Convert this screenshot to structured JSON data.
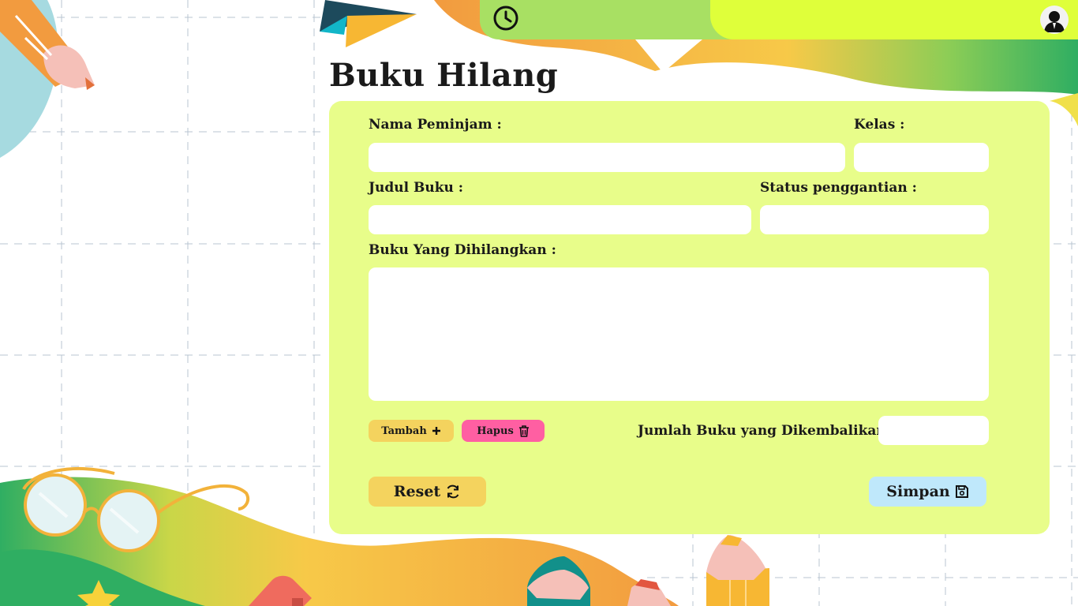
{
  "page": {
    "title": "Buku Hilang"
  },
  "header": {
    "clock_icon": "clock-icon",
    "avatar_icon": "user-avatar-icon"
  },
  "form": {
    "nama_peminjam": {
      "label": "Nama Peminjam :",
      "value": ""
    },
    "kelas": {
      "label": "Kelas :",
      "value": ""
    },
    "judul_buku": {
      "label": "Judul Buku :",
      "value": ""
    },
    "status_penggantian": {
      "label": "Status penggantian :",
      "value": ""
    },
    "buku_dihilangkan": {
      "label": "Buku Yang Dihilangkan :",
      "value": ""
    },
    "jumlah": {
      "label": "Jumlah Buku yang Dikembalikan :",
      "value": ""
    }
  },
  "buttons": {
    "tambah": {
      "label": "Tambah",
      "icon": "plus-icon",
      "color": "#f4d35e"
    },
    "hapus": {
      "label": "Hapus",
      "icon": "trash-icon",
      "color": "#ff5fa2"
    },
    "reset": {
      "label": "Reset",
      "icon": "refresh-icon",
      "color": "#f4d35e"
    },
    "simpan": {
      "label": "Simpan",
      "icon": "save-icon",
      "color": "#bfe8fb"
    }
  },
  "colors": {
    "card": "#e8fd8a",
    "topbar_green": "#a8e063",
    "topbar_yellow": "#dfff3a",
    "grid_line": "#b8c4d2"
  }
}
